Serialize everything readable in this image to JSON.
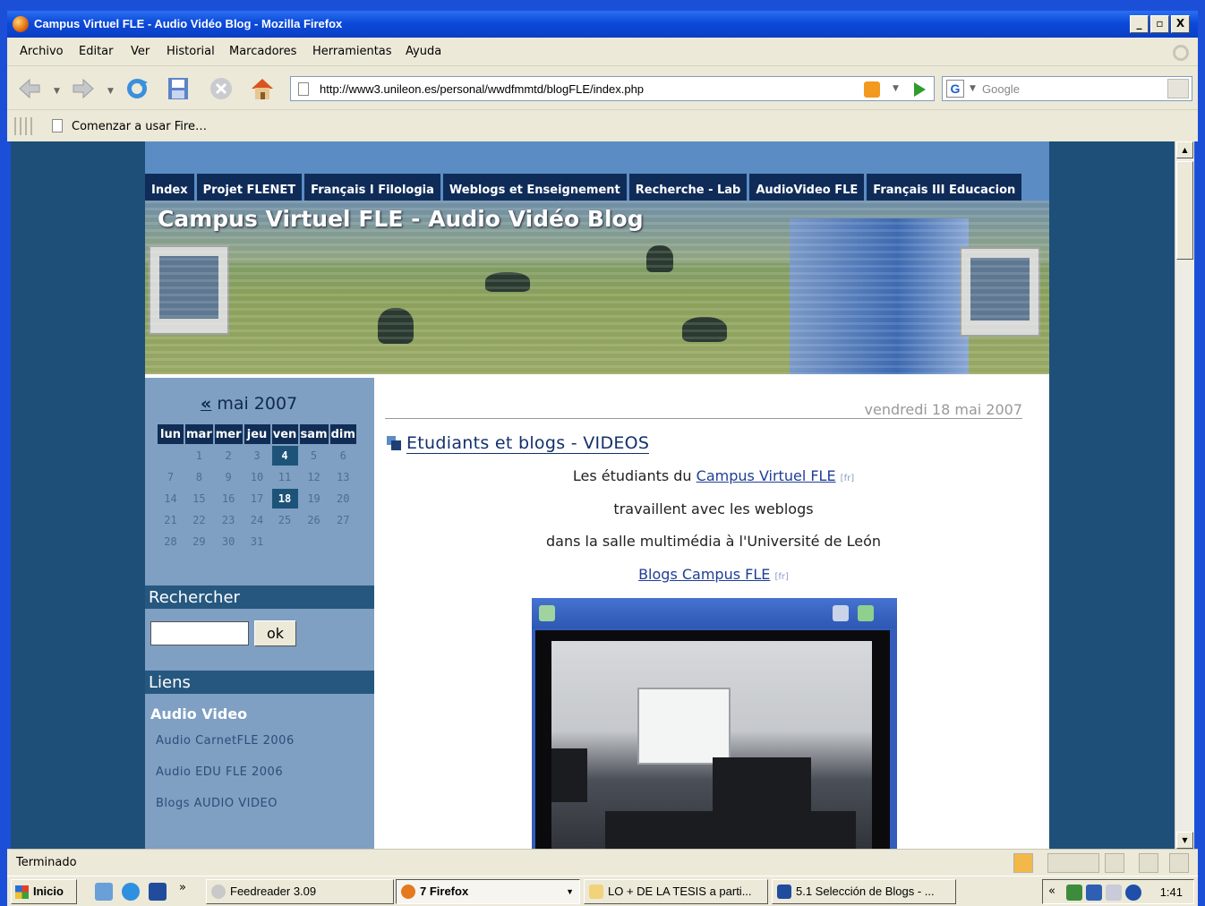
{
  "window": {
    "title": "Campus Virtuel FLE - Audio Vidéo Blog - Mozilla Firefox",
    "min": "_",
    "max": "▫",
    "close": "X"
  },
  "menu": [
    "Archivo",
    "Editar",
    "Ver",
    "Historial",
    "Marcadores",
    "Herramientas",
    "Ayuda"
  ],
  "toolbar": {
    "url": "http://www3.unileon.es/personal/wwdfmmtd/blogFLE/index.php",
    "search_placeholder": "Google",
    "search_engine_letter": "G"
  },
  "bookmarks": [
    "Comenzar a usar Fire…"
  ],
  "site": {
    "nav_tabs": [
      "Index",
      "Projet FLENET",
      "Français I Filologia",
      "Weblogs et Enseignement",
      "Recherche - Lab",
      "AudioVideo FLE",
      "Français III Educacion"
    ],
    "banner_title": "Campus Virtuel FLE - Audio Vidéo Blog"
  },
  "calendar": {
    "prev": "«",
    "month": "mai 2007",
    "days": [
      "lun",
      "mar",
      "mer",
      "jeu",
      "ven",
      "sam",
      "dim"
    ],
    "weeks": [
      [
        "",
        "1",
        "2",
        "3",
        "4",
        "5",
        "6"
      ],
      [
        "7",
        "8",
        "9",
        "10",
        "11",
        "12",
        "13"
      ],
      [
        "14",
        "15",
        "16",
        "17",
        "18",
        "19",
        "20"
      ],
      [
        "21",
        "22",
        "23",
        "24",
        "25",
        "26",
        "27"
      ],
      [
        "28",
        "29",
        "30",
        "31",
        "",
        "",
        ""
      ]
    ],
    "highlighted": [
      "4",
      "18"
    ]
  },
  "sidebar": {
    "search_heading": "Rechercher",
    "search_button": "ok",
    "links_heading": "Liens",
    "links_subheading": "Audio Video",
    "links": [
      "Audio CarnetFLE 2006",
      "Audio EDU FLE 2006",
      "Blogs AUDIO VIDEO"
    ]
  },
  "post": {
    "date": "vendredi 18 mai 2007",
    "title": "Etudiants et blogs - VIDEOS",
    "line1_pre": "Les étudiants du ",
    "line1_link": "Campus Virtuel FLE",
    "lang_tag": "[fr]",
    "line2": "travaillent avec les weblogs",
    "line3": "dans la salle multimédia à l'Université de León",
    "line4_link": "Blogs Campus FLE"
  },
  "status": {
    "text": "Terminado"
  },
  "taskbar": {
    "start": "Inicio",
    "more": "»",
    "buttons": [
      "Feedreader 3.09",
      "7 Firefox",
      "LO + DE LA TESIS a parti...",
      "5.1  Selección de Blogs - ..."
    ],
    "tray_chevron": "«",
    "clock": "1:41"
  },
  "colors": {
    "page_bg": "#1e4f78",
    "nav_tab": "#0f2c59",
    "sidebar": "#7f9fc3",
    "link": "#1f3f95"
  }
}
